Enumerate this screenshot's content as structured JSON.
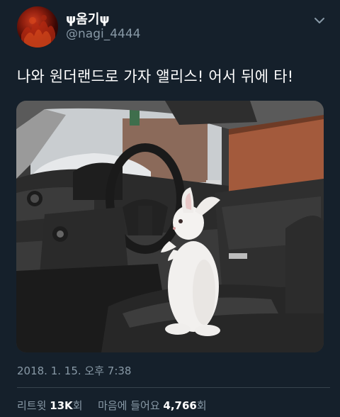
{
  "author": {
    "display_name": "ψ옴기ψ",
    "handle": "@nagi_4444",
    "avatar_icon": "avatar-red-fire"
  },
  "menu": {
    "icon": "chevron-down-icon"
  },
  "tweet": {
    "text": "나와 원더랜드로 가자 앨리스! 어서 뒤에 타!",
    "media_icon": "rabbit-in-car-photo",
    "timestamp": "2018. 1. 15. 오후 7:38"
  },
  "stats": {
    "retweets_label": "리트윗",
    "retweets_count": "13K",
    "retweets_unit": "회",
    "likes_label": "마음에 들어요",
    "likes_count": "4,766",
    "likes_unit": "회"
  },
  "colors": {
    "background": "#15202b",
    "primary_text": "#ffffff",
    "secondary_text": "#8899a6",
    "divider": "#38444d"
  }
}
